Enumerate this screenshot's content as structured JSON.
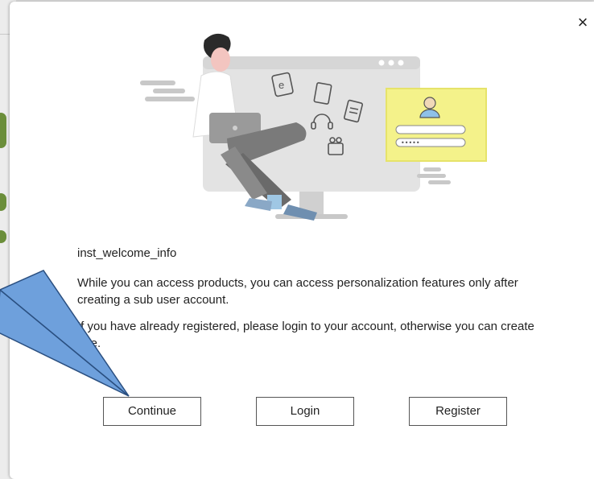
{
  "dialog": {
    "close_glyph": "×",
    "welcome_key": "inst_welcome_info",
    "paragraph_1": "While you can access products, you can access personalization features only after creating a sub user account.",
    "paragraph_2": "If you have already registered, please login to your account, otherwise you can create one.",
    "buttons": {
      "continue": "Continue",
      "login": "Login",
      "register": "Register"
    },
    "illustration_form": {
      "password_mask": "•••••"
    }
  },
  "colors": {
    "accent_yellow": "#f4f28a",
    "callout_blue": "#6ea0dc",
    "person_shirt": "#ffffff",
    "person_pants": "#7a7a7a"
  }
}
